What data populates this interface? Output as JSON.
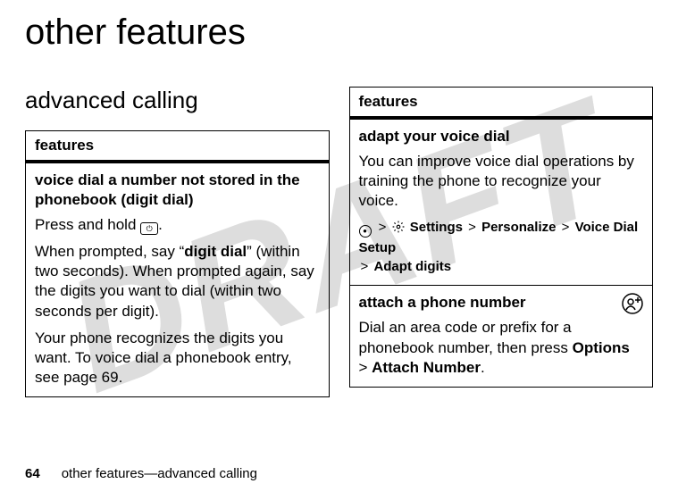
{
  "watermark": "DRAFT",
  "page_title": "other features",
  "section_title": "advanced calling",
  "left_box": {
    "header": "features",
    "item1": {
      "title": "voice dial a number not stored in the phonebook (digit dial)",
      "p1_prefix": "Press and hold ",
      "p1_suffix": ".",
      "key_glyph": "⏻",
      "p2_a": "When prompted, say “",
      "p2_bold": "digit dial",
      "p2_b": "” (within two seconds). When prompted again, say the digits you want to dial (within two  seconds per digit).",
      "p3": "Your phone recognizes the digits you want. To voice dial a phonebook entry, see page 69."
    }
  },
  "right_box": {
    "header": "features",
    "item1": {
      "title": "adapt your voice dial",
      "desc": "You can improve voice dial operations by training the phone to recognize your voice.",
      "path": {
        "center_glyph": "●",
        "sep": ">",
        "step1": "Settings",
        "step2": "Personalize",
        "step3": "Voice Dial Setup",
        "step4": "Adapt digits"
      }
    },
    "item2": {
      "title": "attach a phone number",
      "desc_a": "Dial an area code or prefix for a phonebook number, then press ",
      "desc_opt": "Options",
      "desc_sep": " > ",
      "desc_attach": "Attach Number",
      "desc_end": "."
    }
  },
  "footer": {
    "page_num": "64",
    "section": "other features—advanced calling"
  }
}
